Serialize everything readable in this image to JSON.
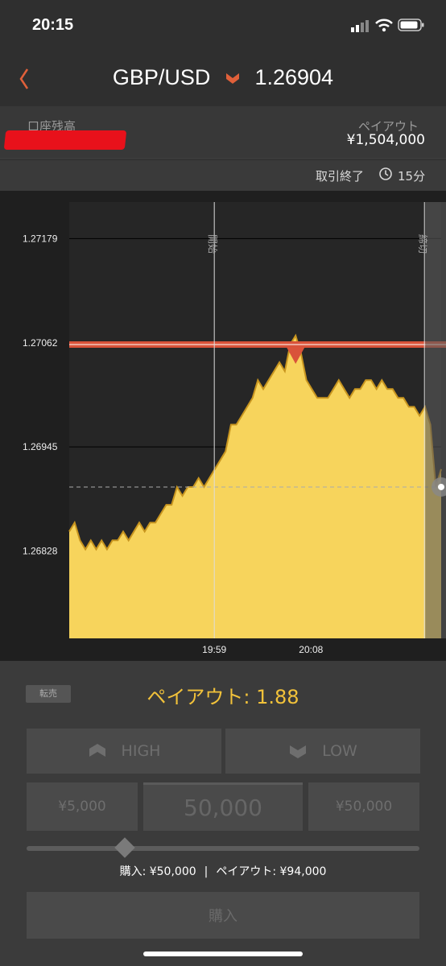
{
  "status_bar": {
    "time": "20:15"
  },
  "header": {
    "pair": "GBP/USD",
    "price": "1.26904",
    "direction": "down",
    "down_color": "#e0603a"
  },
  "account": {
    "balance_label": "口座残高",
    "payout_label": "ペイアウト",
    "payout_value": "¥1,504,000"
  },
  "trade_info": {
    "status": "取引終了",
    "duration": "15分"
  },
  "chart_data": {
    "type": "area",
    "title": "",
    "y_tick_labels": [
      "1.27179",
      "1.27062",
      "1.26945",
      "1.26828"
    ],
    "x_tick_labels": [
      "19:59",
      "20:08"
    ],
    "ylim": [
      1.2673,
      1.2722
    ],
    "markers": {
      "start_label": "開始",
      "end_label": "締切"
    },
    "target_line": 1.2706,
    "fill_color": "#f7d45c",
    "series": [
      {
        "values": [
          1.2685,
          1.2686,
          1.2684,
          1.2683,
          1.2684,
          1.2683,
          1.2684,
          1.2683,
          1.2684,
          1.2684,
          1.2685,
          1.2684,
          1.2685,
          1.2686,
          1.2685,
          1.2686,
          1.2686,
          1.2687,
          1.2688,
          1.2688,
          1.269,
          1.2689,
          1.269,
          1.269,
          1.2691,
          1.269,
          1.2691,
          1.2692,
          1.2693,
          1.2694,
          1.2697,
          1.2697,
          1.2698,
          1.2699,
          1.27,
          1.2702,
          1.2701,
          1.2702,
          1.2703,
          1.2704,
          1.2703,
          1.2706,
          1.2707,
          1.2705,
          1.2702,
          1.2701,
          1.27,
          1.27,
          1.27,
          1.2701,
          1.2702,
          1.2701,
          1.27,
          1.2701,
          1.2701,
          1.2702,
          1.2702,
          1.2701,
          1.2702,
          1.2701,
          1.2701,
          1.27,
          1.27,
          1.2699,
          1.2699,
          1.2698,
          1.2699,
          1.2697,
          1.269,
          1.2692
        ]
      }
    ]
  },
  "controls": {
    "resale_label": "転売",
    "payout_ratio": "ペイアウト: 1.88",
    "high_label": "HIGH",
    "low_label": "LOW",
    "amount_left": "¥5,000",
    "amount_value": "50,000",
    "amount_right": "¥50,000",
    "slider_value": 0.25,
    "purchase_summary": "購入: ¥50,000",
    "payout_summary": "ペイアウト: ¥94,000",
    "buy_label": "購入"
  }
}
